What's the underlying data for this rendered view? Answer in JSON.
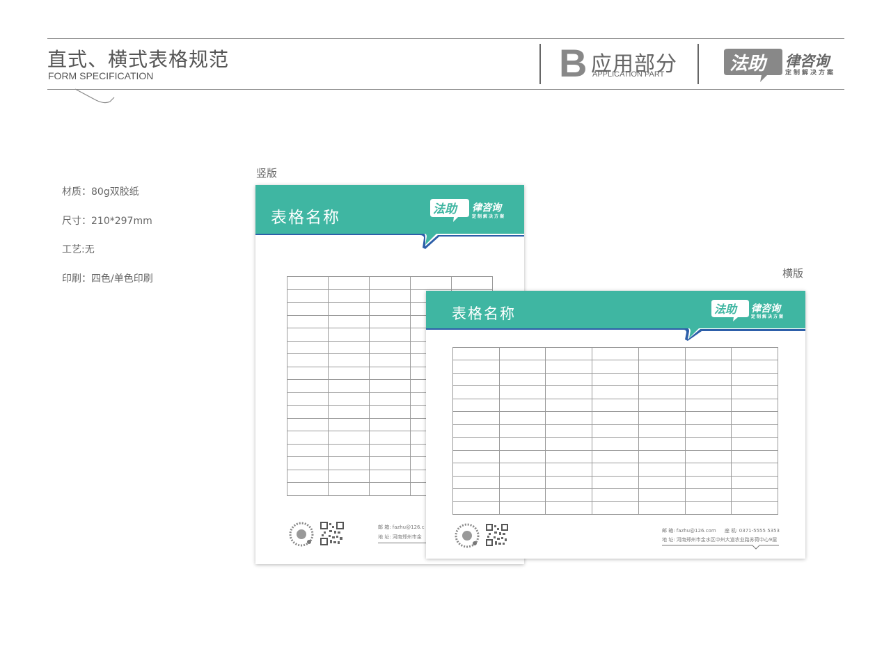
{
  "header": {
    "title": "直式、横式表格规范",
    "subtitle": "FORM SPECIFICATION",
    "section_letter": "B",
    "section_title": "应用部分",
    "section_subtitle": "APPLICATION PART",
    "brand_name": "律咨询",
    "brand_tagline": "定制解决方案"
  },
  "specs": [
    "材质：80g双胶纸",
    "尺寸：210*297mm",
    "工艺:无",
    "印刷：四色/单色印刷"
  ],
  "labels": {
    "vertical": "竖版",
    "horizontal": "横版"
  },
  "vertical_sheet": {
    "title": "表格名称",
    "brand_name": "律咨询",
    "brand_tagline": "定制解决方案",
    "contact_email": "邮  箱: fazhu@126.c",
    "contact_address": "地  址: 河南郑州市金"
  },
  "horizontal_sheet": {
    "title": "表格名称",
    "brand_name": "律咨询",
    "brand_tagline": "定制解决方案",
    "contact_email": "邮  箱: fazhu@126.com",
    "contact_phone": "座  机: 0371-5555 5353",
    "contact_address": "地  址: 河南郑州市金水区中州大道农业路苏荷中心9层"
  },
  "colors": {
    "teal": "#3fb6a2",
    "blue": "#2d5fa9",
    "gray": "#777777"
  },
  "icons": [
    "brand-logo-icon",
    "qr-code-icon",
    "mini-program-code-icon"
  ]
}
